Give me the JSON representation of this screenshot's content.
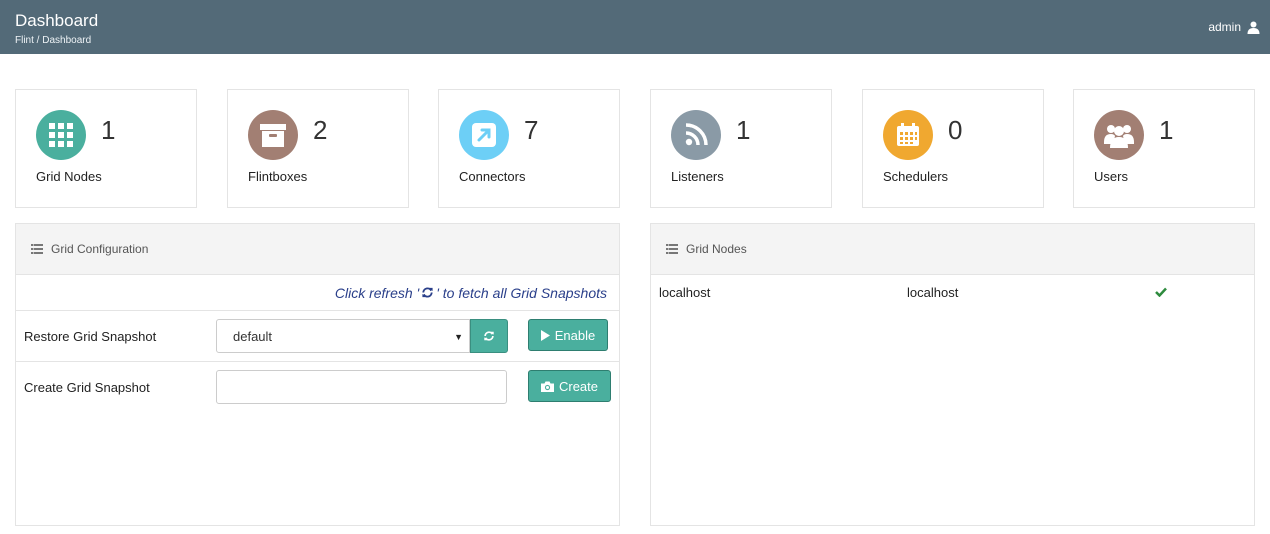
{
  "header": {
    "title": "Dashboard",
    "breadcrumb": "Flint / Dashboard",
    "username": "admin"
  },
  "stats": [
    {
      "label": "Grid Nodes",
      "count": "1",
      "color": "#4aaf9e",
      "icon": "grid-icon"
    },
    {
      "label": "Flintboxes",
      "count": "2",
      "color": "#a27f73",
      "icon": "archive-box-icon"
    },
    {
      "label": "Connectors",
      "count": "7",
      "color": "#6dcff6",
      "icon": "external-link-icon"
    },
    {
      "label": "Listeners",
      "count": "1",
      "color": "#8a9aa6",
      "icon": "rss-icon"
    },
    {
      "label": "Schedulers",
      "count": "0",
      "color": "#f0a830",
      "icon": "calendar-icon"
    },
    {
      "label": "Users",
      "count": "1",
      "color": "#a27f73",
      "icon": "users-icon"
    }
  ],
  "grid_config": {
    "title": "Grid Configuration",
    "hint_before": "Click refresh '",
    "hint_after": "' to fetch all Grid Snapshots",
    "restore_label": "Restore Grid Snapshot",
    "snapshot_selected": "default",
    "enable_label": "Enable",
    "create_label": "Create Grid Snapshot",
    "create_input_value": "",
    "create_button_label": "Create"
  },
  "grid_nodes": {
    "title": "Grid Nodes",
    "rows": [
      {
        "name": "localhost",
        "host": "localhost",
        "status": "ok"
      }
    ]
  },
  "colors": {
    "header_bg": "#536a78",
    "accent": "#4aaf9e",
    "hint_text": "#2a3f8a",
    "status_ok": "#2e8b3e"
  }
}
